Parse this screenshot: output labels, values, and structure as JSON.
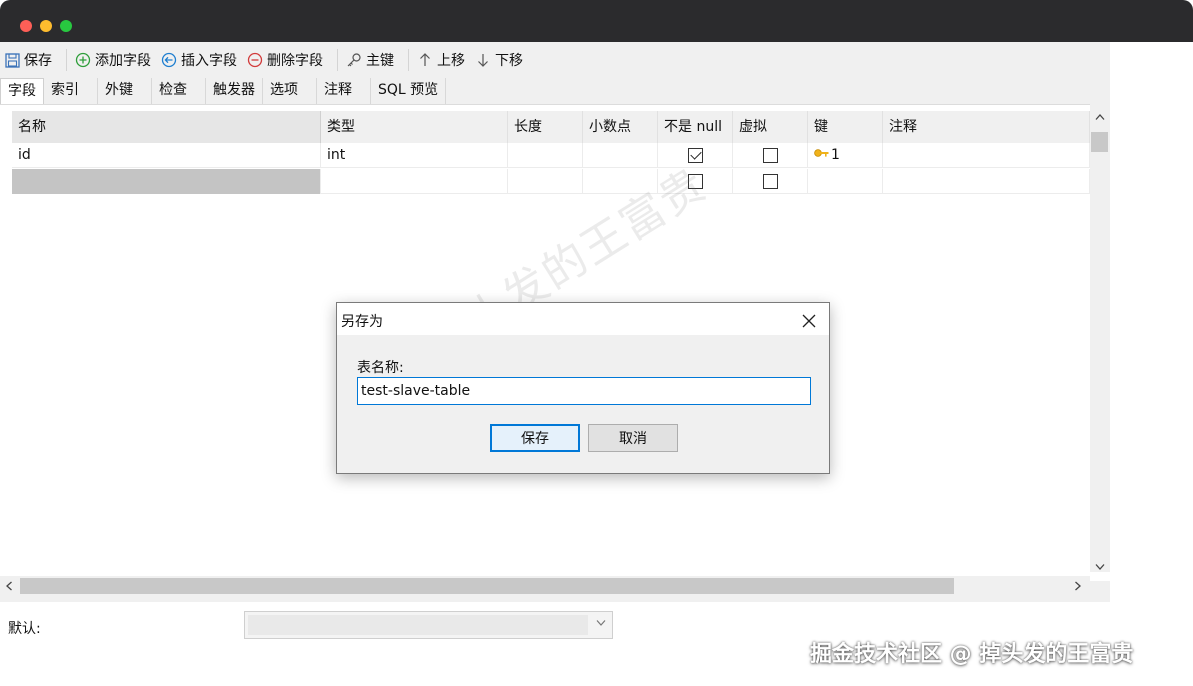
{
  "toolbar": {
    "save": "保存",
    "add_field": "添加字段",
    "insert_field": "插入字段",
    "delete_field": "删除字段",
    "primary_key": "主键",
    "move_up": "上移",
    "move_down": "下移"
  },
  "tabs": [
    "字段",
    "索引",
    "外键",
    "检查",
    "触发器",
    "选项",
    "注释",
    "SQL 预览"
  ],
  "grid": {
    "headers": [
      "名称",
      "类型",
      "长度",
      "小数点",
      "不是 null",
      "虚拟",
      "键",
      "注释"
    ],
    "rows": [
      {
        "name": "id",
        "type": "int",
        "length": "",
        "decimals": "",
        "not_null": true,
        "virtual": false,
        "key": "1",
        "comment": ""
      },
      {
        "name": "",
        "type": "",
        "length": "",
        "decimals": "",
        "not_null": false,
        "virtual": false,
        "key": "",
        "comment": ""
      }
    ]
  },
  "bottom": {
    "default_label": "默认:",
    "default_value": ""
  },
  "dialog": {
    "title": "另存为",
    "label": "表名称:",
    "value": "test-slave-table",
    "save_button": "保存",
    "cancel_button": "取消"
  },
  "watermark": {
    "diagonal": "掉头发的王富贵",
    "footer": "掘金技术社区 @ 掉头发的王富贵"
  }
}
